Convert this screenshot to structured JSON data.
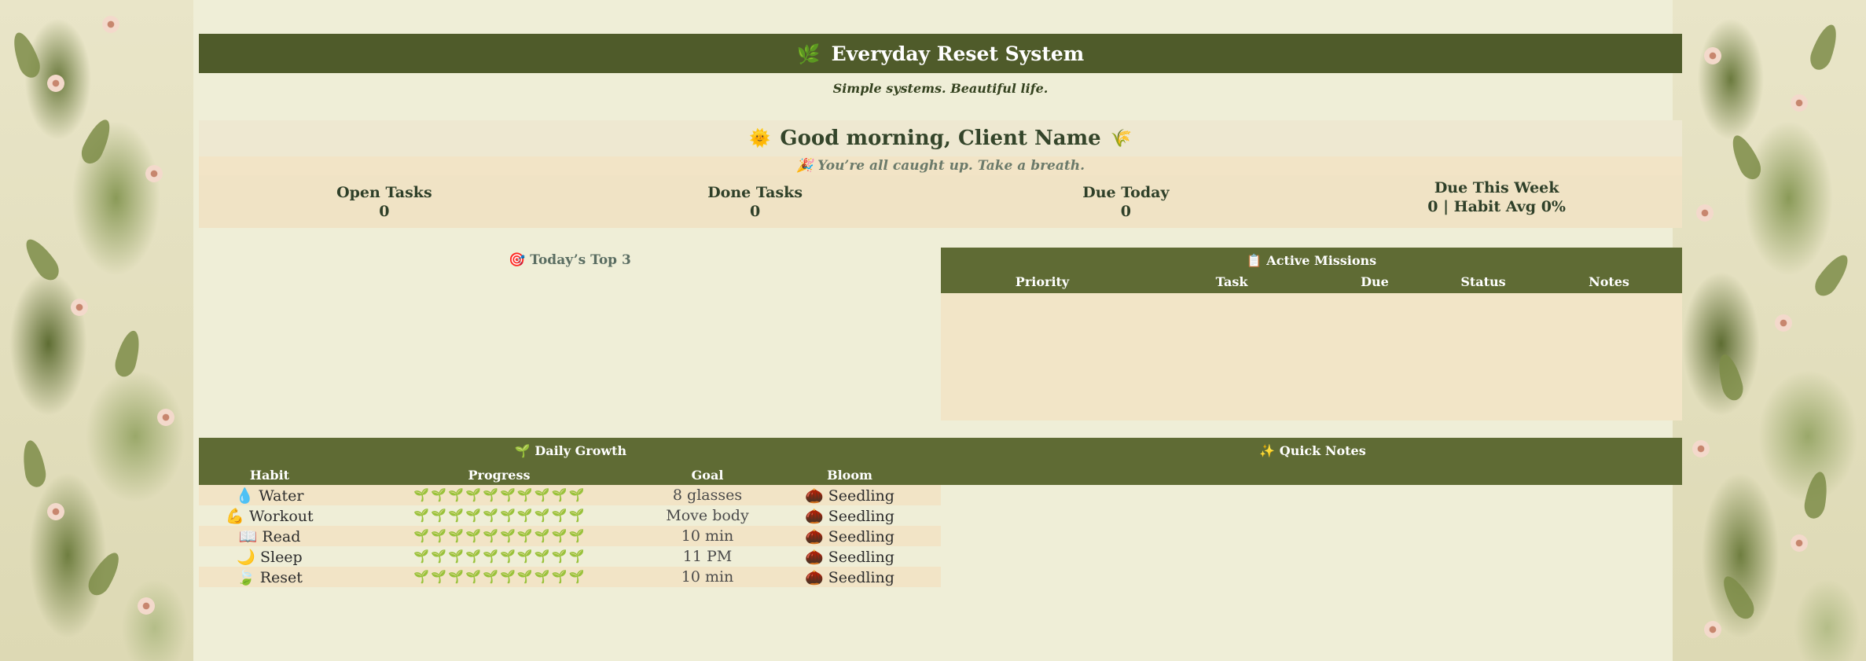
{
  "header": {
    "icon": "🌿",
    "title": "Everyday Reset System",
    "tagline": "Simple systems. Beautiful life."
  },
  "greeting": {
    "icon_left": "🌞",
    "text": "Good morning, Client Name",
    "icon_right": "🌾",
    "caught_up": "🎉 You’re all caught up. Take a breath."
  },
  "stats": [
    {
      "label": "Open Tasks",
      "value": "0"
    },
    {
      "label": "Done Tasks",
      "value": "0"
    },
    {
      "label": "Due Today",
      "value": "0"
    },
    {
      "label": "Due This Week",
      "value": "0 | Habit Avg 0%"
    }
  ],
  "top3": {
    "title": "🎯 Today’s Top 3"
  },
  "missions": {
    "title": "📋 Active Missions",
    "columns": [
      "Priority",
      "Task",
      "Due",
      "Status",
      "Notes"
    ]
  },
  "growth": {
    "title": "🌱 Daily Growth",
    "columns": [
      "Habit",
      "Progress",
      "Goal",
      "Bloom"
    ],
    "rows": [
      {
        "habit": "💧 Water",
        "progress": "🌱🌱🌱🌱🌱🌱🌱🌱🌱🌱",
        "goal": "8 glasses",
        "bloom": "🌰 Seedling"
      },
      {
        "habit": "💪 Workout",
        "progress": "🌱🌱🌱🌱🌱🌱🌱🌱🌱🌱",
        "goal": "Move body",
        "bloom": "🌰 Seedling"
      },
      {
        "habit": "📖 Read",
        "progress": "🌱🌱🌱🌱🌱🌱🌱🌱🌱🌱",
        "goal": "10 min",
        "bloom": "🌰 Seedling"
      },
      {
        "habit": "🌙 Sleep",
        "progress": "🌱🌱🌱🌱🌱🌱🌱🌱🌱🌱",
        "goal": "11 PM",
        "bloom": "🌰 Seedling"
      },
      {
        "habit": "🍃 Reset",
        "progress": "🌱🌱🌱🌱🌱🌱🌱🌱🌱🌱",
        "goal": "10 min",
        "bloom": "🌰 Seedling"
      }
    ]
  },
  "quick_notes": {
    "title": "✨ Quick Notes"
  },
  "colors": {
    "background": "#efeed7",
    "header_green": "#4f5b2a",
    "section_green": "#5f6b34",
    "cream_band": "#f2e4c6"
  }
}
